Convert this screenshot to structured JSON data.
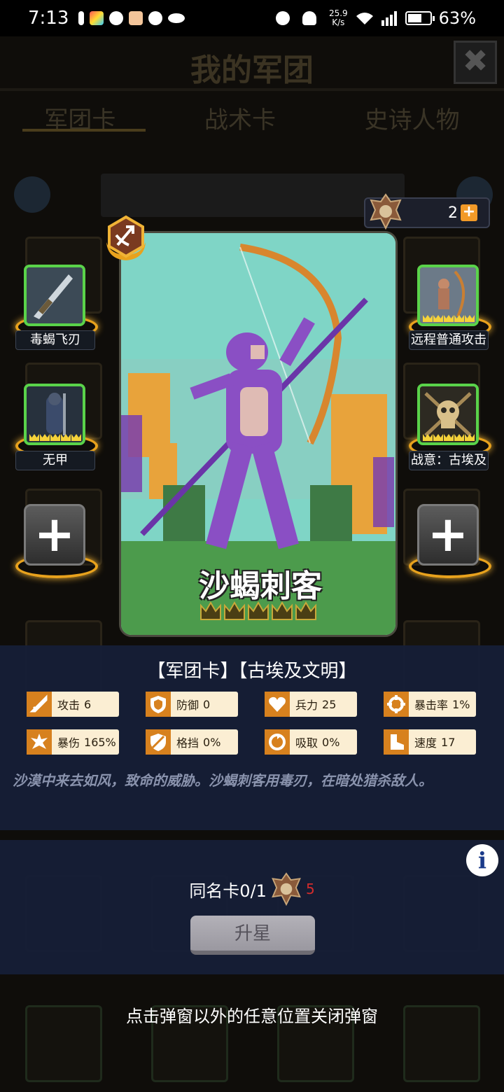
{
  "status_bar": {
    "time": "7:13",
    "net_speed_value": "25.9",
    "net_speed_unit": "K/s",
    "battery": "63%",
    "battery_level": 0.63
  },
  "background": {
    "title": "我的军团",
    "tabs": [
      "军团卡",
      "战术卡",
      "史诗人物"
    ]
  },
  "resources": {
    "gold_count": "2",
    "add_label": "+"
  },
  "card": {
    "name": "沙蝎刺客",
    "star_count": 5,
    "colors": {
      "sky": "#7fd8c9",
      "grass": "#4c9b4c",
      "accent": "#6a35a8"
    }
  },
  "slots": {
    "left": [
      "毒蝎飞刃",
      "无甲"
    ],
    "right": [
      "远程普通攻击",
      "战意：古埃及"
    ],
    "add_label": "+"
  },
  "info": {
    "heading": "【军团卡】【古埃及文明】",
    "stats": [
      {
        "icon": "sword-icon",
        "label": "攻击",
        "value": "6"
      },
      {
        "icon": "shield-icon",
        "label": "防御",
        "value": "0"
      },
      {
        "icon": "heart-icon",
        "label": "兵力",
        "value": "25"
      },
      {
        "icon": "crosshair-icon",
        "label": "暴击率",
        "value": "1%"
      },
      {
        "icon": "burst-icon",
        "label": "暴伤",
        "value": "165%"
      },
      {
        "icon": "block-icon",
        "label": "格挡",
        "value": "0%"
      },
      {
        "icon": "drain-icon",
        "label": "吸取",
        "value": "0%"
      },
      {
        "icon": "boot-icon",
        "label": "速度",
        "value": "17"
      }
    ],
    "description": "沙漠中来去如风，致命的威胁。沙蝎刺客用毒刃，在暗处猎杀敌人。"
  },
  "upgrade": {
    "info_label": "i",
    "duplicate_label": "同名卡0/1",
    "cost": "5",
    "button_label": "升星"
  },
  "close_hint": "点击弹窗以外的任意位置关闭弹窗"
}
